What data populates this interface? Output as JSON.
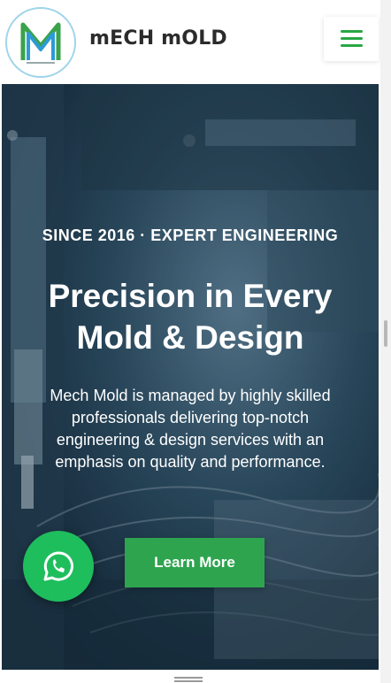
{
  "header": {
    "brand": "mECH mOLD",
    "logo_icon": "mech-mold-logo",
    "menu_icon": "hamburger-menu-icon"
  },
  "hero": {
    "subtitle": "SINCE 2016 · EXPERT ENGINEERING",
    "title_line1": "Precision in Every",
    "title_line2": "Mold & Design",
    "description": "Mech Mold is managed by highly skilled professionals delivering top-notch engineering & design services with an emphasis on quality and performance.",
    "cta_label": "Learn More"
  },
  "floating": {
    "whatsapp_icon": "whatsapp-icon"
  },
  "colors": {
    "accent_green": "#2ea44f",
    "whatsapp_green": "#1ebe5d",
    "brand_text": "#2b2b2b"
  }
}
